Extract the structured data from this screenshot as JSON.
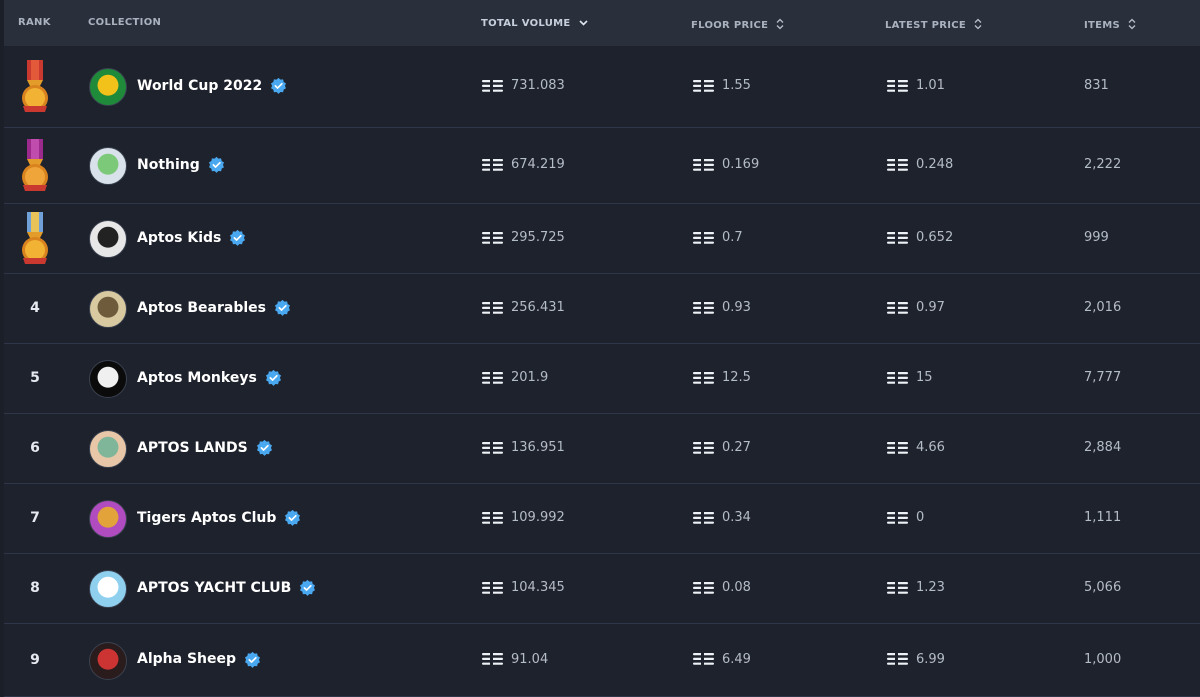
{
  "header": {
    "rank": "RANK",
    "collection": "COLLECTION",
    "total_volume": "TOTAL VOLUME",
    "floor_price": "FLOOR PRICE",
    "latest_price": "LATEST PRICE",
    "items": "ITEMS"
  },
  "colors": {
    "background": "#1e222c",
    "header_bg": "#292f3b",
    "verified": "#4aa8f0",
    "text_primary": "#ffffff",
    "text_secondary": "#b4bcc8"
  },
  "rows": [
    {
      "rank": "",
      "medal": "gold-medal",
      "name": "World Cup 2022",
      "volume": "731.083",
      "floor": "1.55",
      "latest": "1.01",
      "items": "831"
    },
    {
      "rank": "",
      "medal": "purple-medal",
      "name": "Nothing",
      "volume": "674.219",
      "floor": "0.169",
      "latest": "0.248",
      "items": "2,222"
    },
    {
      "rank": "",
      "medal": "bronze-medal",
      "name": "Aptos Kids",
      "volume": "295.725",
      "floor": "0.7",
      "latest": "0.652",
      "items": "999"
    },
    {
      "rank": "4",
      "name": "Aptos Bearables",
      "volume": "256.431",
      "floor": "0.93",
      "latest": "0.97",
      "items": "2,016"
    },
    {
      "rank": "5",
      "name": "Aptos Monkeys",
      "volume": "201.9",
      "floor": "12.5",
      "latest": "15",
      "items": "7,777"
    },
    {
      "rank": "6",
      "name": "APTOS LANDS",
      "volume": "136.951",
      "floor": "0.27",
      "latest": "4.66",
      "items": "2,884"
    },
    {
      "rank": "7",
      "name": "Tigers Aptos Club",
      "volume": "109.992",
      "floor": "0.34",
      "latest": "0",
      "items": "1,111"
    },
    {
      "rank": "8",
      "name": "APTOS YACHT CLUB",
      "volume": "104.345",
      "floor": "0.08",
      "latest": "1.23",
      "items": "5,066"
    },
    {
      "rank": "9",
      "name": "Alpha Sheep",
      "volume": "91.04",
      "floor": "6.49",
      "latest": "6.99",
      "items": "1,000"
    }
  ]
}
